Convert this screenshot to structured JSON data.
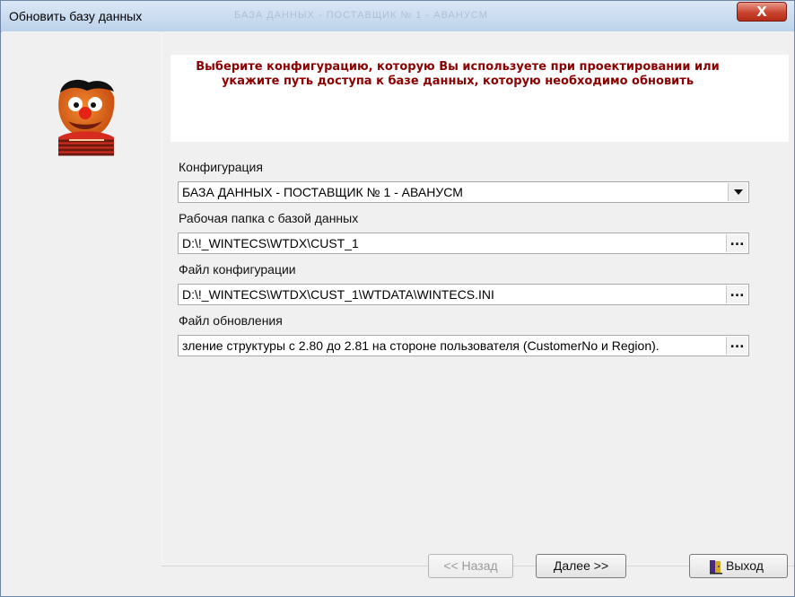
{
  "window": {
    "title": "Обновить базу данных",
    "background_title_text": "БАЗА ДАННЫХ - ПОСТАВЩИК № 1 - АВАНУСМ",
    "close_label": "X"
  },
  "header": {
    "message": "Выберите конфигурацию, которую Вы используете при проектировании или укажите путь доступа к базе данных, которую необходимо обновить"
  },
  "fields": [
    {
      "label": "Конфигурация",
      "value": "БАЗА ДАННЫХ - ПОСТАВЩИК № 1 - АВАНУСМ",
      "type": "dropdown"
    },
    {
      "label": "Рабочая папка с базой данных",
      "value": "D:\\!_WINTECS\\WTDX\\CUST_1",
      "type": "browse",
      "button_label": "..."
    },
    {
      "label": "Файл конфигурации",
      "value": "D:\\!_WINTECS\\WTDX\\CUST_1\\WTDATA\\WINTECS.INI",
      "type": "browse",
      "button_label": "..."
    },
    {
      "label": "Файл обновления",
      "value": "зление структуры с 2.80 до 2.81 на стороне пользователя (CustomerNo и Region).",
      "type": "browse",
      "button_label": "..."
    }
  ],
  "buttons": {
    "back": "<< Назад",
    "next": "Далее >>",
    "exit": "Выход"
  },
  "icons": {
    "mascot": "ernie-mascot-icon",
    "dropdown": "chevron-down-icon",
    "browse": "ellipsis-icon",
    "exit": "exit-door-icon"
  },
  "colors": {
    "message": "#8b0000",
    "close_button": "#c9442f"
  }
}
